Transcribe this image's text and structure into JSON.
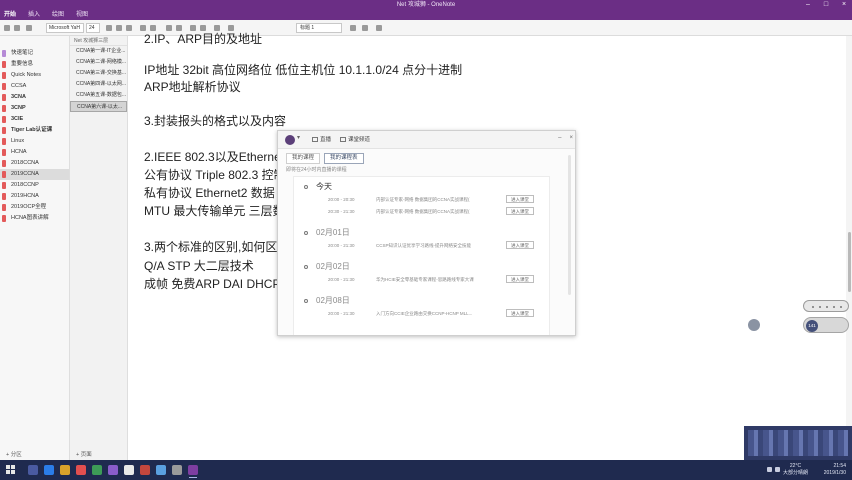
{
  "window": {
    "title": "Net 攻城狮 - OneNote",
    "tabs": [
      "开始",
      "插入",
      "绘图",
      "视图"
    ],
    "active_tab": "开始"
  },
  "ribbon": {
    "font_name": "Microsoft YaH",
    "font_size": "24",
    "style_name": "标题 1"
  },
  "sections": {
    "items": [
      {
        "label": "快速笔记",
        "color": "#b58ad6",
        "bold": false,
        "selected": false
      },
      {
        "label": "重要信息",
        "color": "#e35a5a",
        "bold": false,
        "selected": false
      },
      {
        "label": "Quick Notes",
        "color": "#e35a5a",
        "bold": false,
        "selected": false
      },
      {
        "label": "CCSA",
        "color": "#e35a5a",
        "bold": false,
        "selected": false
      },
      {
        "label": "3CNA",
        "color": "#e35a5a",
        "bold": true,
        "selected": false
      },
      {
        "label": "3CNP",
        "color": "#e35a5a",
        "bold": true,
        "selected": false
      },
      {
        "label": "3CIE",
        "color": "#e35a5a",
        "bold": true,
        "selected": false
      },
      {
        "label": "Tiger Lab认证课",
        "color": "#e35a5a",
        "bold": true,
        "selected": false
      },
      {
        "label": "Linux",
        "color": "#e35a5a",
        "bold": false,
        "selected": false
      },
      {
        "label": "HCNA",
        "color": "#e35a5a",
        "bold": false,
        "selected": false
      },
      {
        "label": "2018CCNA",
        "color": "#e35a5a",
        "bold": false,
        "selected": false
      },
      {
        "label": "2019CCNA",
        "color": "#e35a5a",
        "bold": false,
        "selected": true
      },
      {
        "label": "2018CCNP",
        "color": "#e35a5a",
        "bold": false,
        "selected": false
      },
      {
        "label": "2019HCNA",
        "color": "#e35a5a",
        "bold": false,
        "selected": false
      },
      {
        "label": "2019OCP全程",
        "color": "#e35a5a",
        "bold": false,
        "selected": false
      },
      {
        "label": "HCNA图表讲解",
        "color": "#e35a5a",
        "bold": false,
        "selected": false
      }
    ],
    "add_label": "+ 分区"
  },
  "pages": {
    "search_label": "Net 攻城狮三层",
    "items": [
      {
        "label": "CCNA第一课-IT企业...",
        "selected": false
      },
      {
        "label": "CCNA第二课-网络模...",
        "selected": false
      },
      {
        "label": "CCNA第三课-交换基...",
        "selected": false
      },
      {
        "label": "CCNA第四课-以太网...",
        "selected": false
      },
      {
        "label": "CCNA第五课-数据包...",
        "selected": false
      },
      {
        "label": "CCNA第六课-以太...",
        "selected": true
      }
    ],
    "add_label": "+ 页面"
  },
  "note": {
    "lines": [
      "2.IP、ARP目的及地址",
      "IP地址 32bit  高位网络位  低位主机位  10.1.1.0/24 点分十进制",
      "ARP地址解析协议",
      "3.封装报头的格式以及内容",
      "2.IEEE 802.3以及Ethernet2的区别",
      "公有协议 Triple 802.3 控制",
      "私有协议 Ethernet2    数据",
      "MTU 最大传输单元 三层数据",
      "3.两个标准的区别,如何区分两",
      "Q/A STP 大二层技术",
      "成帧 免费ARP DAI DHCP D"
    ]
  },
  "popup": {
    "btn_live": "直播",
    "btn_class": "课堂频道",
    "tabs": [
      "我的课程",
      "我的课程表"
    ],
    "active_tab": "我的课程表",
    "hint": "即将在24小时内直播的课程",
    "schedule": [
      {
        "day": "今天",
        "active": true,
        "rows": [
          {
            "time": "20:00 - 20:30",
            "text": "内部认证专家-网络 数据集团的CCNA实战课程(",
            "btn": "进入课堂"
          },
          {
            "time": "20:30 - 21:30",
            "text": "内部认证专家-网络 数据集团的CCNA实战课程(",
            "btn": "进入课堂"
          }
        ]
      },
      {
        "day": "02月01日",
        "active": false,
        "rows": [
          {
            "time": "20:00 - 21:30",
            "text": "CCSP知识认证优享学习路线-提升网络安全技能",
            "btn": "进入课堂"
          }
        ]
      },
      {
        "day": "02月02日",
        "active": false,
        "rows": [
          {
            "time": "20:00 - 21:30",
            "text": "华为HCIE安全零基础专家课程-思路路线专家大课",
            "btn": "进入课堂"
          }
        ]
      },
      {
        "day": "02月08日",
        "active": false,
        "rows": [
          {
            "time": "20:00 - 21:30",
            "text": "入门方向CCIE企业路由交换CCNP-HCNP MLL...",
            "btn": "进入课堂"
          }
        ]
      }
    ]
  },
  "floating": {
    "badge_number": "141"
  },
  "taskbar": {
    "temperature": "22°C",
    "weather": "大部分晴朗",
    "time": "21:54",
    "date": "2019/1/30",
    "icon_colors": [
      "#4a5aa0",
      "#2b7de9",
      "#d9a22b",
      "#e24f4f",
      "#3d9b57",
      "#8a5cc9",
      "#e8e8e8",
      "#c5473d",
      "#5aa0e0",
      "#9a9a9a",
      "#7e3ea1"
    ]
  }
}
